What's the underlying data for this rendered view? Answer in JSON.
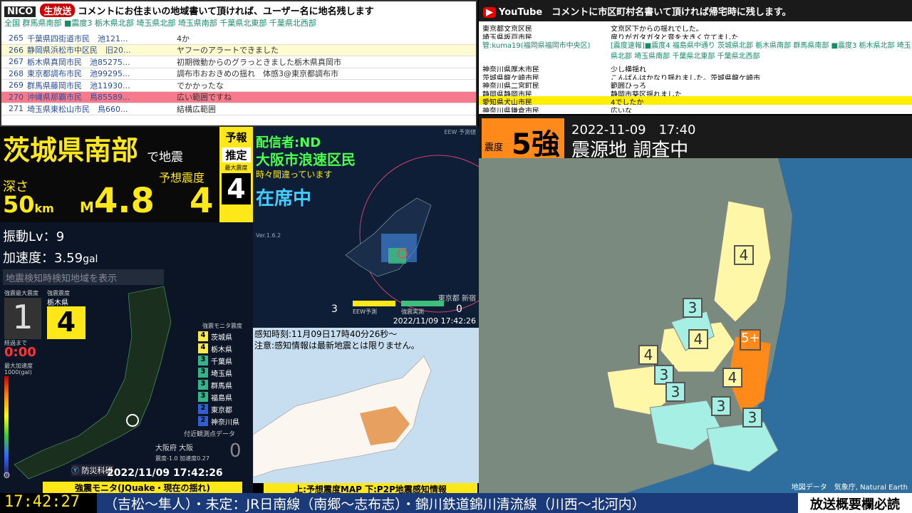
{
  "comments_left": {
    "header_live": "生放送",
    "header_brand": "NICO",
    "header_text": "コメントにお住まいの地域書いて頂ければ、ユーザー名に地名残します",
    "header_sub": "全国 群馬県南部 ■震度3 栃木県北部 埼玉県北部 埼玉県南部 千葉県北東部 千葉県北西部",
    "rows": [
      {
        "no": "265",
        "name": "千葉県四街道市民　池121...",
        "text": "4か"
      },
      {
        "no": "266",
        "name": "静岡県浜松市中区民　旧20...",
        "text": "ヤフーのアラートできました"
      },
      {
        "no": "267",
        "name": "栃木県真岡市民　池85275...",
        "text": "初期微動からのグラっときました栃木県真岡市"
      },
      {
        "no": "268",
        "name": "東京都調布市民　池99295...",
        "text": "調布市おおきめの揺れ　体感3@東京都調布市"
      },
      {
        "no": "269",
        "name": "群馬県藤岡市民　池11930...",
        "text": "でかかったな"
      },
      {
        "no": "270",
        "name": "沖縄県那覇市民　鳥85589...",
        "text": "広い範囲ですね"
      },
      {
        "no": "271",
        "name": "埼玉県東松山市民　鳥660...",
        "text": "結構広範囲"
      }
    ]
  },
  "comments_right": {
    "header_brand": "YouTube",
    "header_text": "コメントに市区町村名書いて頂ければ帰宅時に残します。",
    "rows": [
      {
        "name": "東京都文京区民",
        "text": "文京区下からの揺れでした。"
      },
      {
        "name": "埼玉県坂戸市民",
        "text": "扉りがガタガタと音を大きく立てました"
      },
      {
        "name": "管:kuma19(福岡県福岡市中央区)",
        "text": "[震度速報]■震度4 福島県中通り 茨城県北部 栃木県南部 群馬県南部 ■震度3 栃木県北部 埼玉県北部 埼玉県南部 千葉県北東部 千葉県北西部"
      },
      {
        "name": "神奈川県厚木市民",
        "text": "少し横揺れ"
      },
      {
        "name": "茨城県龍ケ崎市民",
        "text": "こんばんはかなり揺れました。茨城県龍ケ崎市"
      },
      {
        "name": "神奈川県二宮町民",
        "text": "範囲ひっろ"
      },
      {
        "name": "静岡県静岡市民",
        "text": "静岡市葵区揺れました"
      },
      {
        "name": "愛知県犬山市民",
        "text": "4でしたか"
      },
      {
        "name": "神奈川県鎌倉市民",
        "text": "広いな"
      }
    ]
  },
  "eew": {
    "region": "茨城県南部",
    "suffix": "で地震",
    "label_expected": "予想震度",
    "depth_label": "深さ",
    "depth_value": "50",
    "depth_unit": "km",
    "mag_prefix": "M",
    "mag_value": "4.8",
    "expected_intensity": "4",
    "badge_forecast": "予報",
    "badge_estimate": "推定",
    "badge_max": "最大震度",
    "badge_value": "4"
  },
  "streamer": {
    "line1": "配信者:ND",
    "line2": "大阪市浪速区民",
    "line3": "時々間違っています",
    "line4": "在席中"
  },
  "minimap": {
    "version": "Ver.1.6.2",
    "label": "EEW 予測値",
    "left_count": "3",
    "right_count": "0",
    "left_caption": "EEW予測",
    "right_caption": "強震実測",
    "location": "東京都 新宿",
    "timestamp": "2022/11/09 17:42:26"
  },
  "p2p": {
    "line1": "感知時刻:11月09日17時40分26秒～",
    "line2": "注意:感知情報は最新地震とは限りません。"
  },
  "monitor": {
    "vib_label": "振動Lv：",
    "vib_value": "9",
    "acc_label": "加速度：",
    "acc_value": "3.59",
    "acc_unit": "gal",
    "detect_button": "地震検知時検知地域を表示",
    "max_label": "強震最大震度",
    "max_value": "1",
    "pref_label": "強震震度",
    "pref_name": "栃木県",
    "pref_value": "4",
    "timer_label": "経過まで",
    "timer": "0:00",
    "accel_label": "最大加速度",
    "accel_unit": "1000(gal)",
    "legend_title": "強震モニタ震度",
    "legend": [
      {
        "v": "4",
        "name": "茨城県",
        "color": "#ffe84a"
      },
      {
        "v": "4",
        "name": "栃木県",
        "color": "#ffe84a"
      },
      {
        "v": "3",
        "name": "千葉県",
        "color": "#35b38a"
      },
      {
        "v": "3",
        "name": "埼玉県",
        "color": "#35b38a"
      },
      {
        "v": "3",
        "name": "群馬県",
        "color": "#35b38a"
      },
      {
        "v": "3",
        "name": "福島県",
        "color": "#35b38a"
      },
      {
        "v": "2",
        "name": "東京都",
        "color": "#2f5fd0"
      },
      {
        "v": "2",
        "name": "神奈川県",
        "color": "#2f5fd0"
      }
    ],
    "near_label": "付近観測点データ",
    "near_place": "大阪府 大阪",
    "near_shindo": "震度-1.0",
    "near_accel": "加速度0.27",
    "near_value": "0",
    "credit": "防災科研",
    "timestamp": "2022/11/09 17:42:26"
  },
  "captions": {
    "left": "強震モニタ(JQuake・現在の揺れ)",
    "middle": "上:予想震度MAP 下:P2P地震感知情報"
  },
  "right_map": {
    "shindo_label": "震度",
    "shindo_value": "5強",
    "datetime": "2022-11-09　17:40",
    "epicenter": "震源地 調査中",
    "credit": "地図データ　気象庁, Natural Earth",
    "badges": [
      "4",
      "3",
      "4",
      "4",
      "5+",
      "3",
      "3",
      "4",
      "3",
      "3"
    ]
  },
  "ticker": {
    "clock": "17:42:27",
    "text": "（吉松〜隼人）・未定：JR日南線（南郷〜志布志）・錦川鉄道錦川清流線（川西〜北河内）",
    "right": "放送概要欄必読"
  }
}
